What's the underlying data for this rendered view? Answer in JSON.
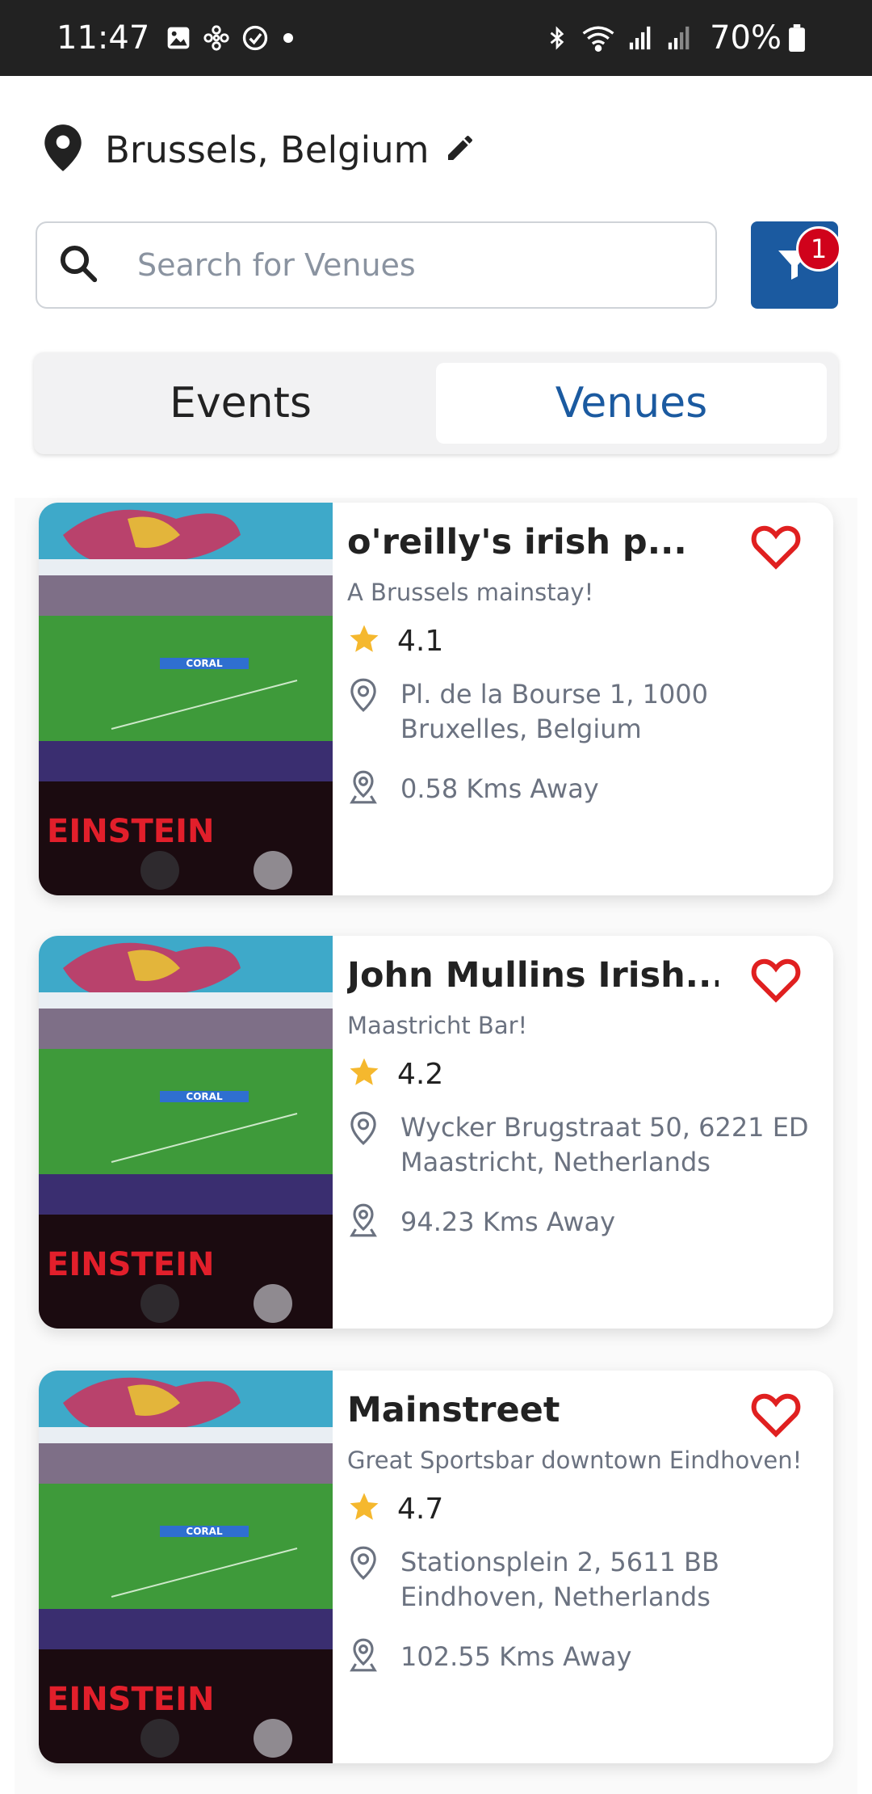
{
  "status_bar": {
    "time": "11:47",
    "battery": "70%",
    "icons": [
      "image-icon",
      "fan-icon",
      "check-circle-icon",
      "dot-icon",
      "bluetooth-icon",
      "wifi-icon",
      "signal-icon",
      "signal-icon",
      "battery-icon"
    ]
  },
  "location": {
    "text": "Brussels, Belgium",
    "pin_icon": "location-pin-icon",
    "edit_icon": "pencil-icon"
  },
  "search": {
    "placeholder": "Search for Venues",
    "value": ""
  },
  "filter": {
    "badge": "1",
    "icon": "filter-icon",
    "color": "#1b5aa0",
    "badge_color": "#d0021b"
  },
  "tabs": [
    {
      "label": "Events",
      "active": false
    },
    {
      "label": "Venues",
      "active": true
    }
  ],
  "accent_color": "#1b5aa0",
  "venues": [
    {
      "name": "o'reilly's irish p...",
      "description": "A Brussels mainstay!",
      "rating": "4.1",
      "address": "Pl. de la Bourse 1, 1000 Bruxelles, Belgium",
      "distance": "0.58 Kms Away"
    },
    {
      "name": "John Mullins Irish...",
      "description": "Maastricht Bar!",
      "rating": "4.2",
      "address": "Wycker Brugstraat 50, 6221 ED Maastricht, Netherlands",
      "distance": "94.23 Kms Away"
    },
    {
      "name": "Mainstreet",
      "description": "Great Sportsbar downtown Eindhoven!",
      "rating": "4.7",
      "address": "Stationsplein 2, 5611 BB Eindhoven, Netherlands",
      "distance": "102.55 Kms Away"
    }
  ],
  "venue_image": {
    "scoreboard_text": "CORAL",
    "sign_text": "EINSTEIN"
  }
}
